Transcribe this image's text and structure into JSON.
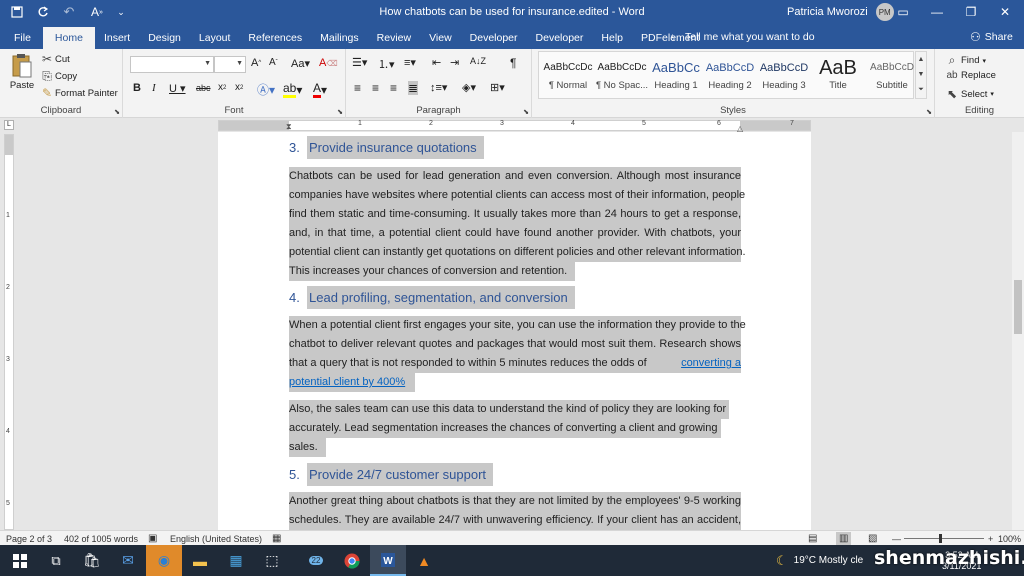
{
  "titlebar": {
    "document_title": "How chatbots can be used for insurance.edited  -  Word",
    "user_name": "Patricia Mworozi",
    "user_initials": "PM"
  },
  "tabs": [
    "File",
    "Home",
    "Insert",
    "Design",
    "Layout",
    "References",
    "Mailings",
    "Review",
    "View",
    "Developer",
    "Developer",
    "Help",
    "PDFelement"
  ],
  "active_tab": "Home",
  "tell_me": "Tell me what you want to do",
  "share": "Share",
  "clipboard": {
    "paste": "Paste",
    "cut": "Cut",
    "copy": "Copy",
    "format_painter": "Format Painter",
    "label": "Clipboard"
  },
  "font": {
    "name": "",
    "size": "",
    "label": "Font"
  },
  "paragraph": {
    "label": "Paragraph"
  },
  "styles": {
    "label": "Styles",
    "items": [
      {
        "sample": "AaBbCcDc",
        "name": "¶ Normal"
      },
      {
        "sample": "AaBbCcDc",
        "name": "¶ No Spac..."
      },
      {
        "sample": "AaBbCc",
        "name": "Heading 1"
      },
      {
        "sample": "AaBbCcD",
        "name": "Heading 2"
      },
      {
        "sample": "AaBbCcD",
        "name": "Heading 3"
      },
      {
        "sample": "AaB",
        "name": "Title"
      },
      {
        "sample": "AaBbCcD",
        "name": "Subtitle"
      }
    ]
  },
  "editing": {
    "find": "Find",
    "replace": "Replace",
    "select": "Select",
    "label": "Editing"
  },
  "ruler": [
    "1",
    "2",
    "3",
    "4",
    "5",
    "6",
    "7"
  ],
  "document": {
    "h3": {
      "num": "3.",
      "text": "Provide insurance quotations"
    },
    "p1": [
      "Chatbots can be used for lead generation and even conversion. Although most insurance",
      "companies have websites where potential clients can access most of their information, people",
      "find them static and time-consuming. It usually takes more than 24 hours to get a response,",
      "and, in that time, a potential client could have found another provider. With chatbots, your",
      "potential client can instantly get quotations on different policies and other relevant information.",
      "This increases your chances of conversion and retention."
    ],
    "h4": {
      "num": "4.",
      "text": "Lead profiling, segmentation, and conversion"
    },
    "p2": [
      "When a potential client first engages your site, you can use the information they provide to the",
      "chatbot to deliver relevant quotes and packages that would most suit them. Research shows",
      "that a query that is not responded to within 5 minutes reduces the odds of"
    ],
    "p2_link_a": "converting a",
    "p2_link_b": "potential client by 400%",
    "p3": [
      "Also, the sales team can use this data to understand the kind of policy they are looking for",
      "accurately. Lead segmentation increases the chances of converting a client and growing",
      "sales."
    ],
    "h5": {
      "num": "5.",
      "text": "Provide 24/7 customer support"
    },
    "p4": [
      "Another great thing about chatbots is that they are not limited by the employees' 9-5 working",
      "schedules. They are available 24/7 with unwavering efficiency. If your client has an accident,"
    ]
  },
  "status": {
    "page": "Page 2 of 3",
    "words": "402 of 1005 words",
    "language": "English (United States)",
    "zoom": "100%"
  },
  "taskbar": {
    "weather": "19°C  Mostly cle",
    "badge": "22",
    "time": "3:52 AM",
    "date": "3/11/2021"
  },
  "watermark": "shenmazhishi.com",
  "colors": {
    "word_blue": "#2b579a",
    "heading_blue": "#2f5496",
    "selection_gray": "#c8c8c8",
    "link": "#0563c1"
  }
}
